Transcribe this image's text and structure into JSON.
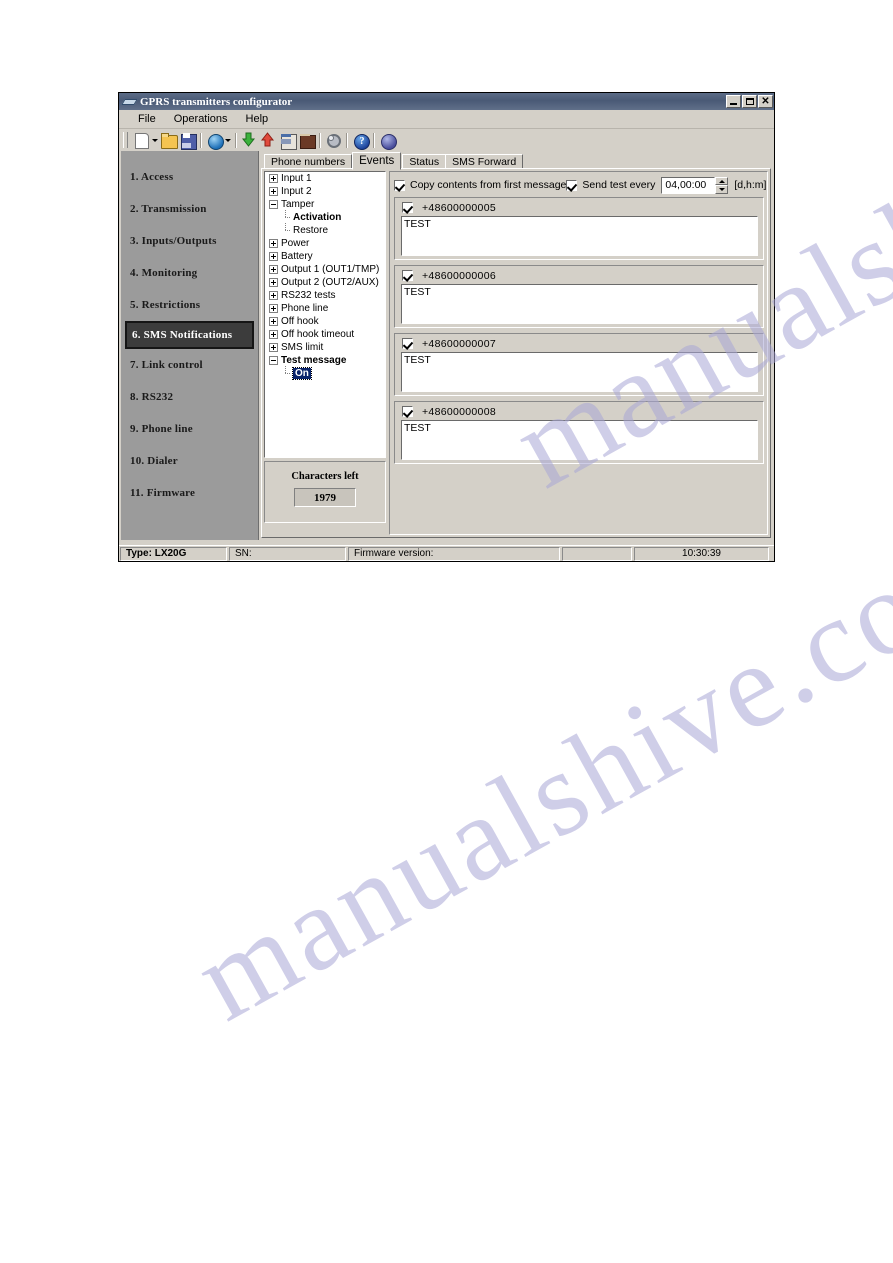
{
  "window": {
    "title": "GPRS transmitters configurator",
    "icon": "app-icon",
    "buttons": {
      "minimize": "_",
      "maximize": "□",
      "close": "×"
    }
  },
  "menubar": {
    "items": [
      {
        "label": "File"
      },
      {
        "label": "Operations"
      },
      {
        "label": "Help"
      }
    ]
  },
  "toolbar": {
    "items": [
      {
        "icon": "new-document-icon",
        "dropdown": true
      },
      {
        "icon": "open-folder-icon",
        "dropdown": false
      },
      {
        "icon": "save-icon",
        "dropdown": false
      },
      {
        "icon": "globe-connection-icon",
        "dropdown": true
      },
      {
        "icon": "download-to-device-icon",
        "dropdown": false
      },
      {
        "icon": "upload-from-device-icon",
        "dropdown": false
      },
      {
        "icon": "device-info-icon",
        "dropdown": false
      },
      {
        "icon": "event-log-book-icon",
        "dropdown": false
      },
      {
        "icon": "settings-gear-icon",
        "dropdown": false
      },
      {
        "icon": "help-question-icon",
        "dropdown": false
      },
      {
        "icon": "about-planet-icon",
        "dropdown": false
      }
    ]
  },
  "sidebar": {
    "items": [
      {
        "label": "1. Access",
        "selected": false
      },
      {
        "label": "2. Transmission",
        "selected": false
      },
      {
        "label": "3. Inputs/Outputs",
        "selected": false
      },
      {
        "label": "4. Monitoring",
        "selected": false
      },
      {
        "label": "5. Restrictions",
        "selected": false
      },
      {
        "label": "6. SMS Notifications",
        "selected": true
      },
      {
        "label": "7. Link control",
        "selected": false
      },
      {
        "label": "8. RS232",
        "selected": false
      },
      {
        "label": "9. Phone line",
        "selected": false
      },
      {
        "label": "10. Dialer",
        "selected": false
      },
      {
        "label": "11. Firmware",
        "selected": false
      }
    ]
  },
  "tabs": [
    {
      "label": "Phone numbers",
      "active": false
    },
    {
      "label": "Events",
      "active": true
    },
    {
      "label": "Status",
      "active": false
    },
    {
      "label": "SMS Forward",
      "active": false
    }
  ],
  "tree": {
    "nodes": [
      {
        "label": "Input 1",
        "level": 0,
        "expander": "plus",
        "bold": false,
        "selected": false
      },
      {
        "label": "Input 2",
        "level": 0,
        "expander": "plus",
        "bold": false,
        "selected": false
      },
      {
        "label": "Tamper",
        "level": 0,
        "expander": "minus",
        "bold": false,
        "selected": false
      },
      {
        "label": "Activation",
        "level": 1,
        "expander": "leaf",
        "bold": true,
        "selected": false
      },
      {
        "label": "Restore",
        "level": 1,
        "expander": "leaf",
        "bold": false,
        "selected": false
      },
      {
        "label": "Power",
        "level": 0,
        "expander": "plus",
        "bold": false,
        "selected": false
      },
      {
        "label": "Battery",
        "level": 0,
        "expander": "plus",
        "bold": false,
        "selected": false
      },
      {
        "label": "Output 1 (OUT1/TMP)",
        "level": 0,
        "expander": "plus",
        "bold": false,
        "selected": false
      },
      {
        "label": "Output 2 (OUT2/AUX)",
        "level": 0,
        "expander": "plus",
        "bold": false,
        "selected": false
      },
      {
        "label": "RS232 tests",
        "level": 0,
        "expander": "plus",
        "bold": false,
        "selected": false
      },
      {
        "label": "Phone line",
        "level": 0,
        "expander": "plus",
        "bold": false,
        "selected": false
      },
      {
        "label": "Off hook",
        "level": 0,
        "expander": "plus",
        "bold": false,
        "selected": false
      },
      {
        "label": "Off hook timeout",
        "level": 0,
        "expander": "plus",
        "bold": false,
        "selected": false
      },
      {
        "label": "SMS limit",
        "level": 0,
        "expander": "plus",
        "bold": false,
        "selected": false
      },
      {
        "label": "Test message",
        "level": 0,
        "expander": "minus",
        "bold": true,
        "selected": false
      },
      {
        "label": "On",
        "level": 1,
        "expander": "leaf",
        "bold": true,
        "selected": true
      }
    ]
  },
  "characters_panel": {
    "label": "Characters left",
    "value": "1979"
  },
  "options": {
    "copy_contents": {
      "label": "Copy contents from first message",
      "checked": true
    },
    "send_test": {
      "label": "Send test every",
      "checked": true
    },
    "interval_value": "04,00:00",
    "interval_unit": "[d,h:m]"
  },
  "phone_groups": [
    {
      "number": "+48600000005",
      "checked": true,
      "message": "TEST"
    },
    {
      "number": "+48600000006",
      "checked": true,
      "message": "TEST"
    },
    {
      "number": "+48600000007",
      "checked": true,
      "message": "TEST"
    },
    {
      "number": "+48600000008",
      "checked": true,
      "message": "TEST"
    }
  ],
  "statusbar": {
    "type": "Type: LX20G",
    "sn": "SN:",
    "firmware": "Firmware version:",
    "blank": "",
    "time": "10:30:39"
  },
  "watermark": {
    "line1": "manualshive.com",
    "line2": "manualshive.com"
  }
}
